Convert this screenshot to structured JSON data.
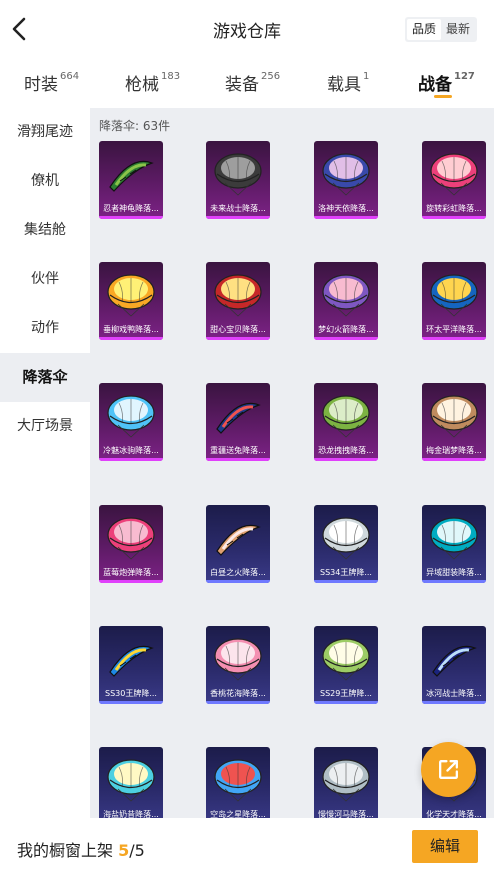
{
  "header": {
    "title": "游戏仓库",
    "sort": {
      "options": [
        "品质",
        "最新"
      ],
      "active": 0
    }
  },
  "tabs": [
    {
      "label": "时装",
      "count": "664"
    },
    {
      "label": "枪械",
      "count": "183"
    },
    {
      "label": "装备",
      "count": "256"
    },
    {
      "label": "载具",
      "count": "1"
    },
    {
      "label": "战备",
      "count": "127",
      "active": true
    }
  ],
  "sidebar": {
    "items": [
      {
        "label": "滑翔尾迹"
      },
      {
        "label": "僚机"
      },
      {
        "label": "集结舱"
      },
      {
        "label": "伙伴"
      },
      {
        "label": "动作"
      },
      {
        "label": "降落伞",
        "active": true
      },
      {
        "label": "大厅场景"
      }
    ]
  },
  "main": {
    "count_label": "降落伞: 63件",
    "items": [
      {
        "name": "忍者神龟降落...",
        "rarity": "purple",
        "icon": "glider-icon",
        "colors": [
          "#2e7d32",
          "#8bc34a"
        ]
      },
      {
        "name": "未来战士降落...",
        "rarity": "purple",
        "icon": "parachute-icon",
        "colors": [
          "#3b3b3b",
          "#9e9e9e"
        ]
      },
      {
        "name": "洛神天依降落...",
        "rarity": "purple",
        "icon": "parachute-icon",
        "colors": [
          "#3949ab",
          "#e1bee7"
        ]
      },
      {
        "name": "旋转彩虹降落...",
        "rarity": "purple",
        "icon": "parachute-icon",
        "colors": [
          "#ec407a",
          "#ffcdd2"
        ]
      },
      {
        "name": "垂柳戏鸭降落...",
        "rarity": "purple",
        "icon": "parachute-icon",
        "colors": [
          "#f9a825",
          "#fff176"
        ]
      },
      {
        "name": "甜心宝贝降落...",
        "rarity": "purple",
        "icon": "parachute-icon",
        "colors": [
          "#c62828",
          "#ffe082"
        ]
      },
      {
        "name": "梦幻火箭降落...",
        "rarity": "purple",
        "icon": "parachute-icon",
        "colors": [
          "#7e57c2",
          "#f8bbd0"
        ]
      },
      {
        "name": "环太平洋降落...",
        "rarity": "purple",
        "icon": "parachute-icon",
        "colors": [
          "#1565c0",
          "#ffd54f"
        ]
      },
      {
        "name": "冷魅冰驹降落...",
        "rarity": "purple",
        "icon": "parachute-icon",
        "colors": [
          "#4fc3f7",
          "#e1f5fe"
        ]
      },
      {
        "name": "重疆送兔降落...",
        "rarity": "purple",
        "icon": "glider-icon",
        "colors": [
          "#1e3a8a",
          "#ef5350"
        ]
      },
      {
        "name": "恐龙拽拽降落...",
        "rarity": "purple",
        "icon": "parachute-icon",
        "colors": [
          "#7cb342",
          "#dcedc8"
        ]
      },
      {
        "name": "梅金瑞梦降落...",
        "rarity": "purple",
        "icon": "parachute-icon",
        "colors": [
          "#bf8b5e",
          "#fff3e0"
        ]
      },
      {
        "name": "蓝莓炮弹降落...",
        "rarity": "purple",
        "icon": "parachute-icon",
        "colors": [
          "#ec407a",
          "#f8bbd0"
        ]
      },
      {
        "name": "白昼之火降落...",
        "rarity": "blue",
        "icon": "glider-icon",
        "colors": [
          "#e0a070",
          "#fbe9e7"
        ]
      },
      {
        "name": "SS34王牌降...",
        "rarity": "blue",
        "icon": "parachute-icon",
        "colors": [
          "#cfd8dc",
          "#ffffff"
        ]
      },
      {
        "name": "异域甜装降落...",
        "rarity": "blue",
        "icon": "parachute-icon",
        "colors": [
          "#00acc1",
          "#e0f7fa"
        ]
      },
      {
        "name": "SS30王牌降...",
        "rarity": "blue",
        "icon": "glider-icon",
        "colors": [
          "#1e88e5",
          "#fdd835"
        ]
      },
      {
        "name": "香桃花海降落...",
        "rarity": "blue",
        "icon": "parachute-icon",
        "colors": [
          "#f48fb1",
          "#fce4ec"
        ]
      },
      {
        "name": "SS29王牌降...",
        "rarity": "blue",
        "icon": "parachute-icon",
        "colors": [
          "#9ccc65",
          "#fffde7"
        ]
      },
      {
        "name": "冰河战士降落...",
        "rarity": "blue",
        "icon": "glider-icon",
        "colors": [
          "#1a237e",
          "#bbdefb"
        ]
      },
      {
        "name": "海盐奶昔降落...",
        "rarity": "blue",
        "icon": "parachute-icon",
        "colors": [
          "#4dd0e1",
          "#fff9c4"
        ]
      },
      {
        "name": "空岛之星降落...",
        "rarity": "blue",
        "icon": "parachute-icon",
        "colors": [
          "#42a5f5",
          "#ef5350"
        ]
      },
      {
        "name": "慢慢河马降落...",
        "rarity": "blue",
        "icon": "parachute-icon",
        "colors": [
          "#b0bec5",
          "#eceff1"
        ]
      },
      {
        "name": "化学天才降落...",
        "rarity": "blue",
        "icon": "parachute-icon",
        "colors": [
          "#3949ab",
          "#e8eaf6"
        ]
      }
    ]
  },
  "bottom_bar": {
    "label": "我的橱窗上架",
    "current": "5",
    "separator": "/",
    "total": "5",
    "edit_label": "编辑"
  },
  "colors": {
    "accent": "#f5a623",
    "purple_rarity": "#7d2286",
    "blue_rarity": "#2a2a6a"
  }
}
